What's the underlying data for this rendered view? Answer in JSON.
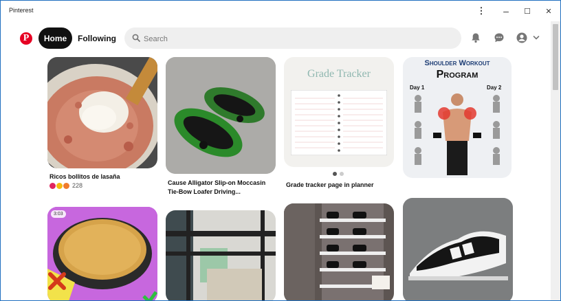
{
  "window": {
    "title": "Pinterest",
    "controls": {
      "more": "⋮",
      "minimize": "–",
      "maximize": "☐",
      "close": "✕"
    }
  },
  "nav": {
    "logo": "P",
    "home_label": "Home",
    "following_label": "Following",
    "search_placeholder": "Search",
    "icons": [
      "search-icon",
      "bell-icon",
      "chat-icon",
      "avatar-icon",
      "chevron-down-icon"
    ]
  },
  "colors": {
    "brand": "#e60023",
    "active_tab": "#111111",
    "search_bg": "#efefef"
  },
  "pins": [
    {
      "title": "Ricos bollitos de lasaña",
      "reaction_count": "228",
      "reactions": [
        "heart",
        "heart-eyes",
        "wow"
      ]
    },
    {
      "title_line1": "Cause Alligator Slip-on Moccasin",
      "title_line2": "Tie-Bow Loafer Driving..."
    },
    {
      "image_text": "Grade Tracker",
      "title": "Grade tracker page in planner",
      "carousel_count": 2,
      "carousel_active": 1
    },
    {
      "header_line1": "Shoulder Workout",
      "header_line2": "Program",
      "day1": "Day 1",
      "day2": "Day 2"
    },
    {
      "video_duration": "3:03"
    },
    {},
    {},
    {}
  ]
}
